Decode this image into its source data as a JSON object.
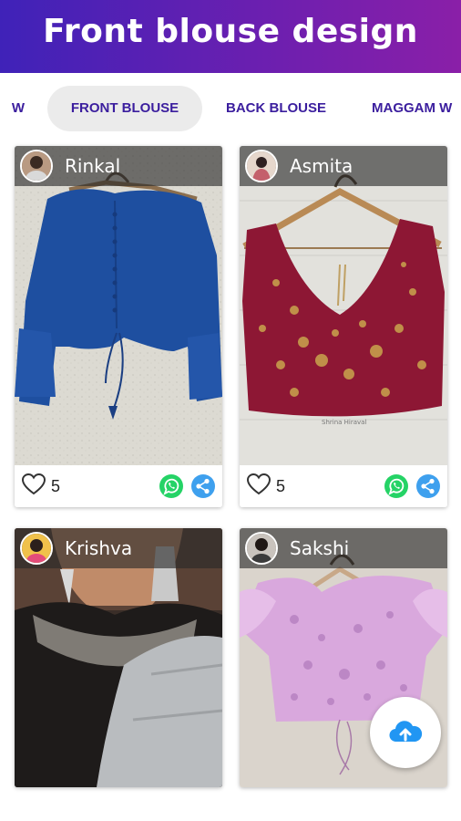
{
  "app": {
    "title": "Front blouse design"
  },
  "tabs": [
    {
      "label": "W"
    },
    {
      "label": "FRONT BLOUSE",
      "active": true
    },
    {
      "label": "BACK BLOUSE"
    },
    {
      "label": "MAGGAM W"
    }
  ],
  "posts": [
    {
      "user": "Rinkal",
      "likes": "5",
      "photo": "blue blouse with bell sleeves"
    },
    {
      "user": "Asmita",
      "likes": "5",
      "photo": "maroon embroidered sleeveless blouse"
    },
    {
      "user": "Krishva",
      "likes": "",
      "photo": "black blouse with white embroidery and grey saree"
    },
    {
      "user": "Sakshi",
      "likes": "",
      "photo": "lilac blouse with ruffle sleeves"
    }
  ],
  "colors": {
    "header_start": "#3f22b8",
    "header_end": "#8a1fa8",
    "tab_text": "#3b1e9e",
    "whatsapp": "#25d366",
    "share": "#3ea0ee",
    "upload": "#2196f3"
  },
  "icons": {
    "like": "heart-outline-icon",
    "whatsapp": "whatsapp-icon",
    "share": "share-icon",
    "upload": "cloud-upload-icon"
  }
}
